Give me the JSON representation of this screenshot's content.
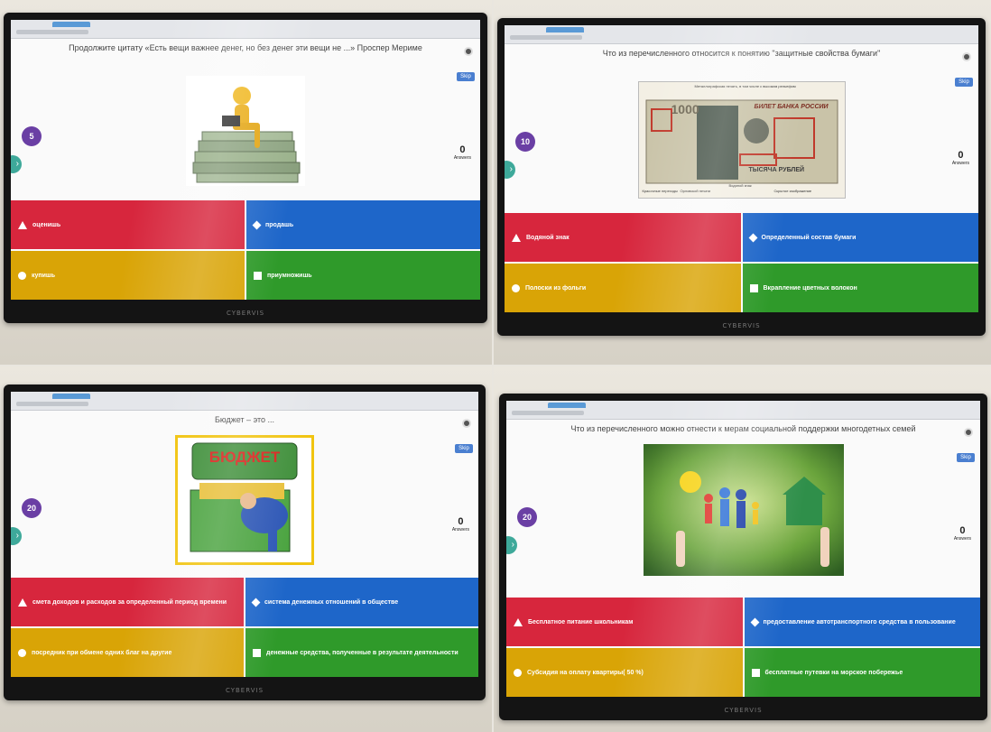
{
  "panels": [
    {
      "question": "Продолжите цитату «Есть вещи важнее денег, но без денег эти вещи не ...» Проспер Мериме",
      "timer": "5",
      "answers_count": "0",
      "answers_label": "Answers",
      "skip_label": "Skip",
      "brand": "CYBERVIS",
      "image": "man-on-money-stack",
      "options": [
        {
          "label": "оценишь",
          "color": "#d7263d",
          "shape": "triangle-icon"
        },
        {
          "label": "продашь",
          "color": "#1e66c9",
          "shape": "diamond-icon"
        },
        {
          "label": "купишь",
          "color": "#d9a406",
          "shape": "circle-icon"
        },
        {
          "label": "приумножишь",
          "color": "#2f9a2a",
          "shape": "square-icon"
        }
      ]
    },
    {
      "question": "Что из перечисленного относится к понятию \"защитные свойства бумаги\"",
      "timer": "10",
      "answers_count": "0",
      "answers_label": "Answers",
      "skip_label": "Skip",
      "brand": "CYBERVIS",
      "image": "banknote-1000-rubles",
      "banknote_text": "БИЛЕТ БАНКА РОССИИ",
      "banknote_value": "1000",
      "banknote_currency": "ТЫСЯЧА РУБЛЕЙ",
      "banknote_labels": [
        "Водяной знак",
        "Скрытое изображение",
        "Красочные переходы",
        "Орловской печати",
        "Металлографская печать, в том числе с высоким рельефом"
      ],
      "options": [
        {
          "label": "Водяной знак",
          "color": "#d7263d",
          "shape": "triangle-icon"
        },
        {
          "label": "Определенный состав бумаги",
          "color": "#1e66c9",
          "shape": "diamond-icon"
        },
        {
          "label": "Полоски из фольги",
          "color": "#d9a406",
          "shape": "circle-icon"
        },
        {
          "label": "Вкрапление цветных волокон",
          "color": "#2f9a2a",
          "shape": "square-icon"
        }
      ]
    },
    {
      "question": "Бюджет – это ...",
      "timer": "20",
      "answers_count": "0",
      "answers_label": "Answers",
      "skip_label": "Skip",
      "brand": "CYBERVIS",
      "image": "budget-treasure-chest",
      "image_text": "БЮДЖЕТ",
      "options": [
        {
          "label": "смета доходов и расходов за определенный период времени",
          "color": "#d7263d",
          "shape": "triangle-icon"
        },
        {
          "label": "система денежных отношений в обществе",
          "color": "#1e66c9",
          "shape": "diamond-icon"
        },
        {
          "label": "посредник при обмене одних благ на другие",
          "color": "#d9a406",
          "shape": "circle-icon"
        },
        {
          "label": "денежные средства, полученные в результате деятельности",
          "color": "#2f9a2a",
          "shape": "square-icon"
        }
      ]
    },
    {
      "question": "Что из перечисленного можно отнести к мерам социальной поддержки многодетных семей",
      "timer": "20",
      "answers_count": "0",
      "answers_label": "Answers",
      "skip_label": "Skip",
      "brand": "CYBERVIS",
      "image": "paper-family-cutout",
      "options": [
        {
          "label": "Бесплатное питание школьникам",
          "color": "#d7263d",
          "shape": "triangle-icon"
        },
        {
          "label": "предоставление автотранспортного средства в пользование",
          "color": "#1e66c9",
          "shape": "diamond-icon"
        },
        {
          "label": "Субсидия на оплату квартиры( 50 %)",
          "color": "#d9a406",
          "shape": "circle-icon"
        },
        {
          "label": "бесплатные путевки на морское побережье",
          "color": "#2f9a2a",
          "shape": "square-icon"
        }
      ]
    }
  ]
}
